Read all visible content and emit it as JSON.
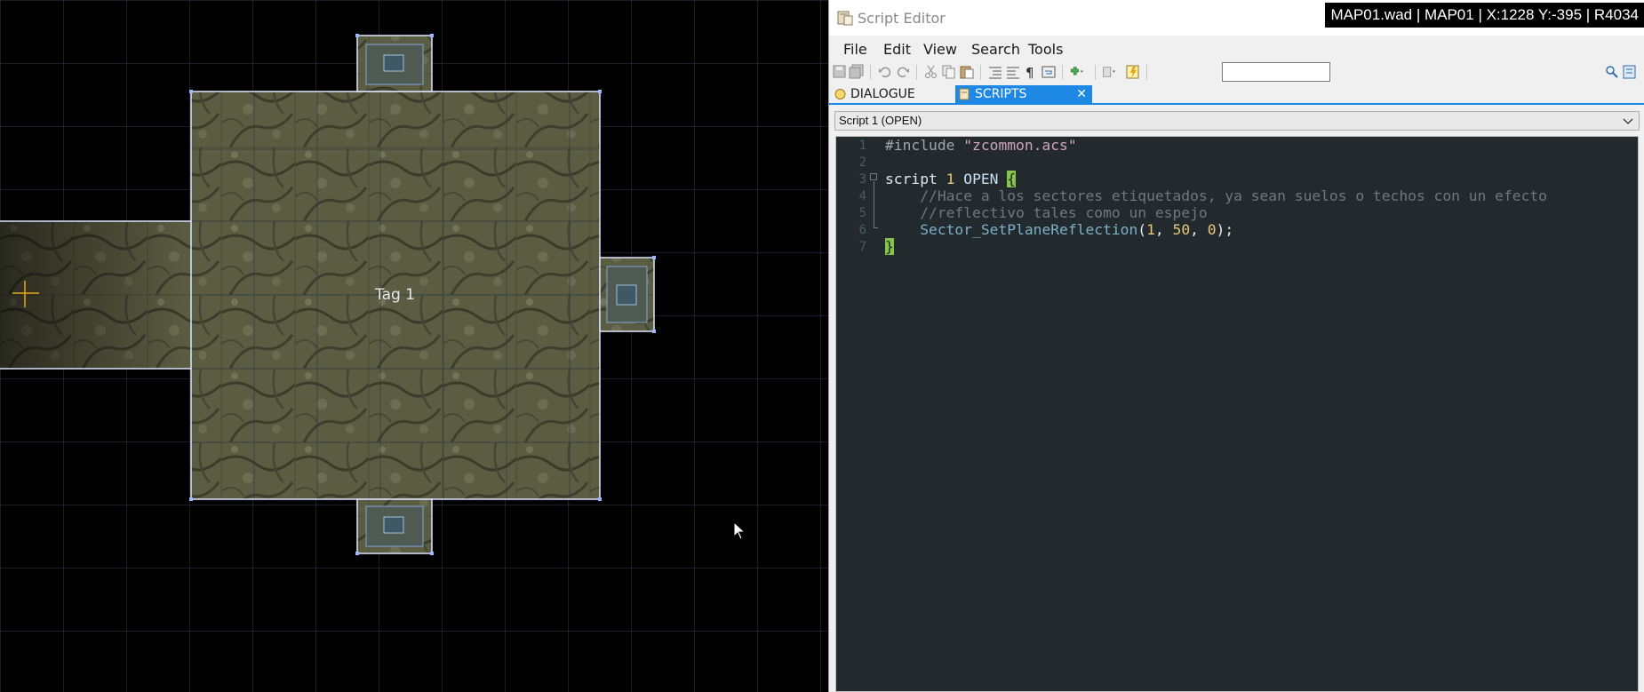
{
  "map": {
    "tag_label": "Tag 1"
  },
  "editor": {
    "title": "Script Editor",
    "status_readout": "MAP01.wad | MAP01 | X:1228 Y:-395 | R4034",
    "menu": [
      "File",
      "Edit",
      "View",
      "Search",
      "Tools"
    ],
    "find_value": "",
    "tabs": [
      {
        "label": "DIALOGUE",
        "active": false
      },
      {
        "label": "SCRIPTS",
        "active": true,
        "close": "✕"
      }
    ],
    "script_selector": "Script 1 (OPEN)",
    "line_numbers": [
      "1",
      "2",
      "3",
      "4",
      "5",
      "6",
      "7"
    ],
    "code": {
      "line1": {
        "directive": "#include",
        "path": "\"zcommon.acs\""
      },
      "line3": {
        "keyword": "script",
        "number": "1",
        "type": "OPEN",
        "brace": "{"
      },
      "line4": {
        "comment": "//Hace a los sectores etiquetados, ya sean suelos o techos con un efecto"
      },
      "line5": {
        "comment": "//reflectivo tales como un espejo"
      },
      "line6": {
        "function": "Sector_SetPlaneReflection",
        "open": "(",
        "arg1": "1",
        "sep1": ", ",
        "arg2": "50",
        "sep2": ", ",
        "arg3": "0",
        "close": ");"
      },
      "line7": {
        "brace": "}"
      }
    }
  },
  "colors": {
    "accent": "#1e88e5",
    "code_bg": "#232a2d",
    "brace_highlight": "#86c34a",
    "map_grid": "#3a3f55"
  }
}
